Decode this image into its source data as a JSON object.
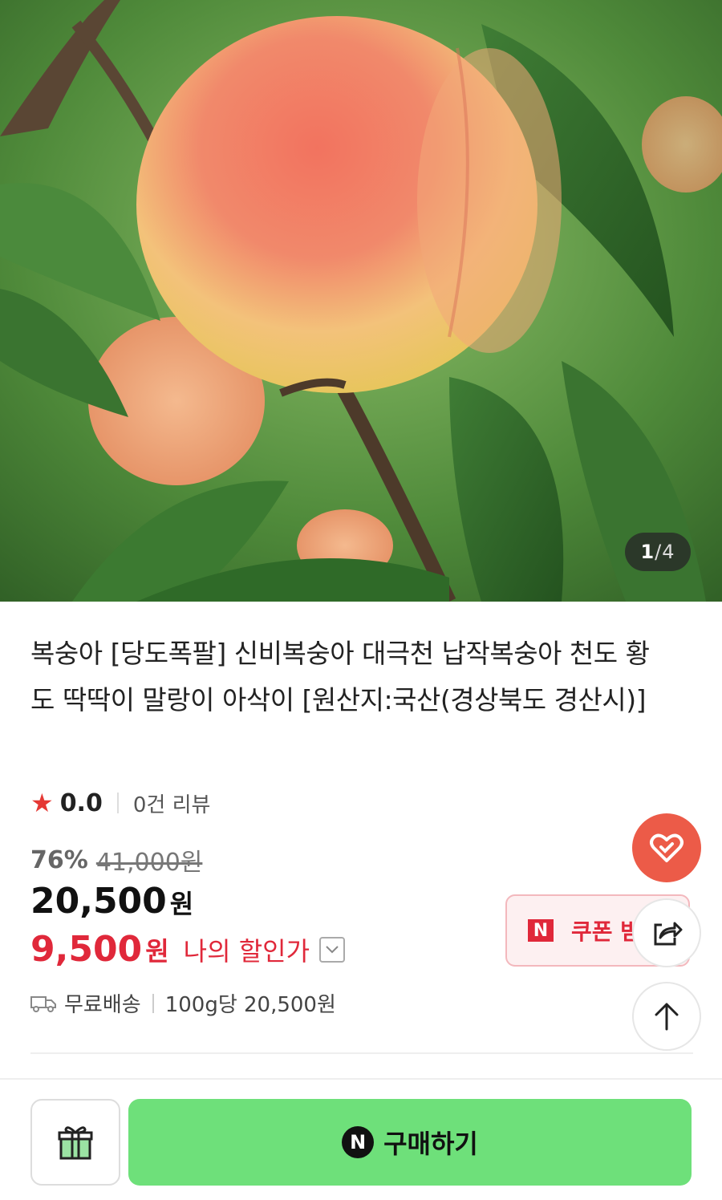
{
  "hero": {
    "image_alt": "peach on tree",
    "counter_current": "1",
    "counter_sep": "/",
    "counter_total": "4"
  },
  "product": {
    "title": "복숭아 [당도폭팔] 신비복숭아 대극천 납작복숭아 천도 황도 딱딱이 말랑이 아삭이 [원산지:국산(경상북도 경산시)]"
  },
  "rating": {
    "star_icon": "★",
    "score": "0.0",
    "reviews": "0건 리뷰"
  },
  "price": {
    "discount_pct": "76%",
    "original": "41,000원",
    "sale": "20,500",
    "sale_unit": "원",
    "my_price": "9,500",
    "my_price_unit": "원",
    "my_price_label": "나의 할인가"
  },
  "shipping": {
    "label": "무료배송",
    "unit_price": "100g당 20,500원"
  },
  "coupon": {
    "badge": "N",
    "label": "쿠폰 받"
  },
  "bottom": {
    "buy_badge": "N",
    "buy_label": "구매하기"
  },
  "colors": {
    "accent_red": "#e0283a",
    "heart_fab": "#ec5b48",
    "buy_green": "#6ee07a"
  }
}
